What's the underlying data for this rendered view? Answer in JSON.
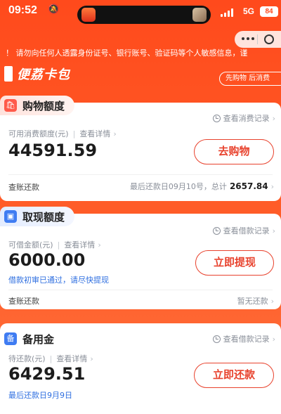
{
  "status_bar": {
    "time": "09:52",
    "network": "5G",
    "battery": "84"
  },
  "notice": {
    "text": "！ 请勿向任何人透露身份证号、银行账号、验证码等个人敏感信息，谨"
  },
  "brand": {
    "name": "便荔卡包",
    "pill": "先购物 后消费"
  },
  "shopping": {
    "title": "购物额度",
    "record_link": "查看消费记录",
    "available_label": "可用消费额度(元)",
    "detail_link": "查看详情",
    "amount": "44591.59",
    "action": "去购物",
    "bill_link": "查账还款",
    "due_text": "最后还款日09月10号，总计",
    "due_total": "2657.84"
  },
  "cash": {
    "title": "取现额度",
    "record_link": "查看借款记录",
    "available_label": "可借金额(元)",
    "detail_link": "查看详情",
    "amount": "6000.00",
    "action": "立即提现",
    "status_text": "借款初审已通过，请尽快提现",
    "bill_link": "查账还款",
    "repay_status": "暂无还款"
  },
  "reserve": {
    "title": "备用金",
    "record_link": "查看借款记录",
    "pending_label": "待还款(元)",
    "detail_link": "查看详情",
    "amount": "6429.51",
    "action": "立即还款",
    "due_text": "最后还款日9月9日"
  },
  "colors": {
    "accent": "#e8422d",
    "background": "#ff4a1c",
    "link_blue": "#2f6fe0"
  }
}
